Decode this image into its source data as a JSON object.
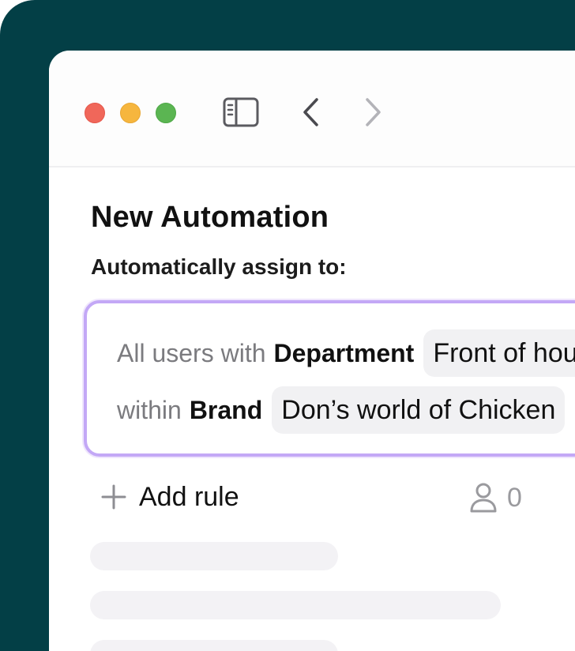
{
  "window": {
    "title": "New Automation",
    "subtitle": "Automatically assign to:"
  },
  "rule": {
    "line1": {
      "prefix": "All users with",
      "field": "Department",
      "value": "Front of house"
    },
    "line2": {
      "prefix": "within",
      "field": "Brand",
      "value": "Don’s world of Chicken"
    }
  },
  "actions": {
    "add_rule_label": "Add rule",
    "user_count": "0"
  },
  "colors": {
    "backdrop": "#033f46",
    "accent_border": "#c3a8f6",
    "close": "#f0675a",
    "minimize": "#f6b63e",
    "zoom": "#5bb552"
  },
  "icons": {
    "sidebar": "sidebar-toggle-icon",
    "back": "chevron-left-icon",
    "forward": "chevron-right-icon",
    "add": "plus-icon",
    "users": "user-icon"
  }
}
